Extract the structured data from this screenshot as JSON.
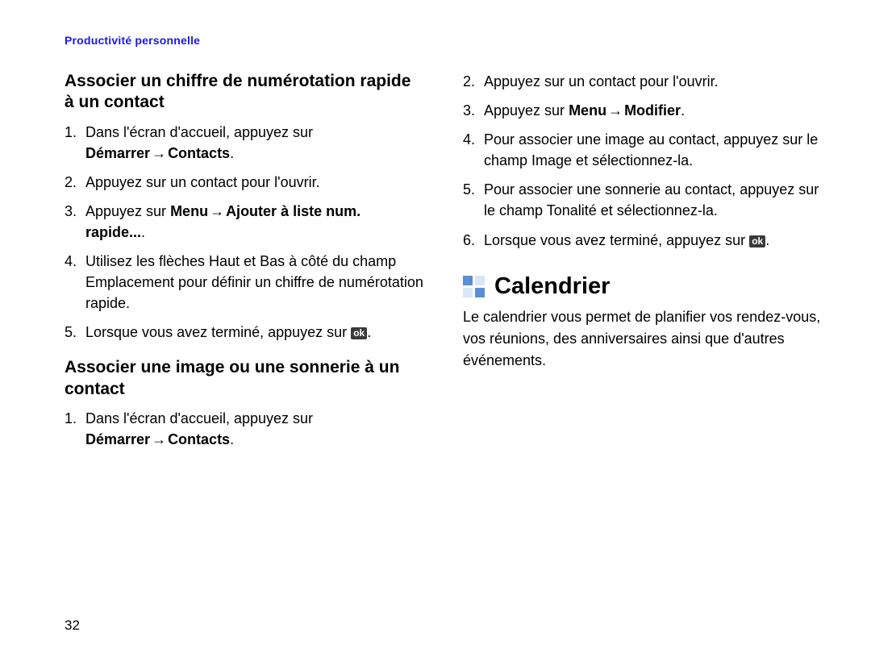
{
  "header": {
    "breadcrumb": "Productivité personnelle"
  },
  "left": {
    "section1": {
      "title": "Associer un chiffre de numérotation rapide à un contact",
      "steps": {
        "s1_a": "Dans l'écran d'accueil, appuyez sur ",
        "s1_b1": "Démarrer",
        "s1_b2": "Contacts",
        "s1_c": ".",
        "s2": "Appuyez sur un contact pour l'ouvrir.",
        "s3_a": "Appuyez sur ",
        "s3_b1": "Menu",
        "s3_b2": "Ajouter à liste num. rapide...",
        "s3_c": ".",
        "s4": "Utilisez les flèches Haut et Bas à côté du champ Emplacement pour définir un chiffre de numérotation rapide.",
        "s5_a": "Lorsque vous avez terminé, appuyez sur ",
        "s5_c": "."
      }
    },
    "section2": {
      "title": "Associer une image ou une sonnerie à un contact",
      "steps": {
        "s1_a": "Dans l'écran d'accueil, appuyez sur ",
        "s1_b1": "Démarrer",
        "s1_b2": "Contacts",
        "s1_c": "."
      }
    }
  },
  "right": {
    "cont_steps": {
      "s2": "Appuyez sur un contact pour l'ouvrir.",
      "s3_a": "Appuyez sur ",
      "s3_b1": "Menu",
      "s3_b2": "Modifier",
      "s3_c": ".",
      "s4": "Pour associer une image au contact, appuyez sur le champ Image et sélectionnez-la.",
      "s5": "Pour associer une sonnerie au contact, appuyez sur le champ Tonalité et sélectionnez-la.",
      "s6_a": "Lorsque vous avez terminé, appuyez sur ",
      "s6_c": "."
    },
    "calendar": {
      "title": "Calendrier",
      "intro": "Le calendrier vous permet de planifier vos rendez-vous, vos réunions, des anniversaires ainsi que d'autres événements."
    }
  },
  "icons": {
    "ok_label": "ok",
    "arrow": "→"
  },
  "page_number": "32"
}
